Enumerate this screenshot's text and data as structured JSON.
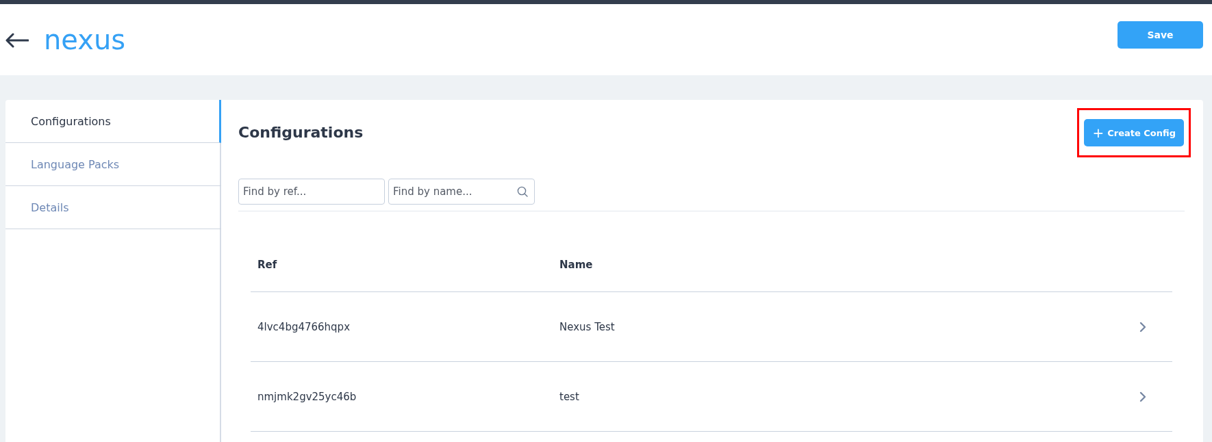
{
  "header": {
    "title": "nexus",
    "save_label": "Save"
  },
  "sidebar": {
    "items": [
      {
        "label": "Configurations",
        "selected": true
      },
      {
        "label": "Language Packs",
        "selected": false
      },
      {
        "label": "Details",
        "selected": false
      }
    ]
  },
  "section": {
    "title": "Configurations",
    "create_label": "Create Config",
    "create_icon": "+",
    "highlighted": true
  },
  "filters": [
    {
      "placeholder": "Find by ref...",
      "search_icon": false
    },
    {
      "placeholder": "Find by name...",
      "search_icon": true
    }
  ],
  "table": {
    "columns": [
      "Ref",
      "Name"
    ],
    "rows": [
      {
        "ref": "4lvc4bg4766hqpx",
        "name": "Nexus Test"
      },
      {
        "ref": "nmjmk2gv25yc46b",
        "name": "test"
      }
    ]
  }
}
